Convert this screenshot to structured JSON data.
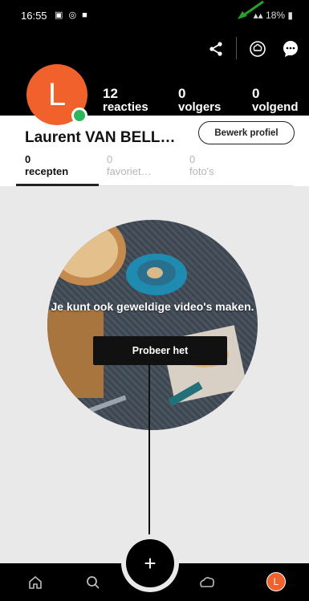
{
  "status_bar": {
    "time": "16:55",
    "left_icons": "▣ ◎ ■",
    "right": "18%"
  },
  "header": {
    "avatar_letter": "L",
    "stats": [
      {
        "value": "12",
        "label": "reacties"
      },
      {
        "value": "0",
        "label": "volgers"
      },
      {
        "value": "0",
        "label": "volgend"
      }
    ],
    "icons": [
      "share-icon",
      "chef-hat-icon",
      "chat-icon"
    ]
  },
  "profile": {
    "name": "Laurent VAN BELL…",
    "edit_label": "Bewerk profiel",
    "tabs": [
      {
        "count": "0",
        "label": "recepten"
      },
      {
        "count": "0",
        "label": "favoriet…"
      },
      {
        "count": "0",
        "label": "foto's"
      }
    ]
  },
  "promo": {
    "text": "Je kunt ook geweldige video's maken.",
    "cta_label": "Probeer het"
  },
  "nav": {
    "fab_label": "+",
    "avatar_letter": "L",
    "items": [
      "home-icon",
      "search-icon",
      "add-button",
      "activity-icon",
      "profile-avatar"
    ]
  },
  "colors": {
    "accent": "#f0612b",
    "online": "#2fb55b",
    "dark": "#000000",
    "background": "#e9e9e9"
  }
}
